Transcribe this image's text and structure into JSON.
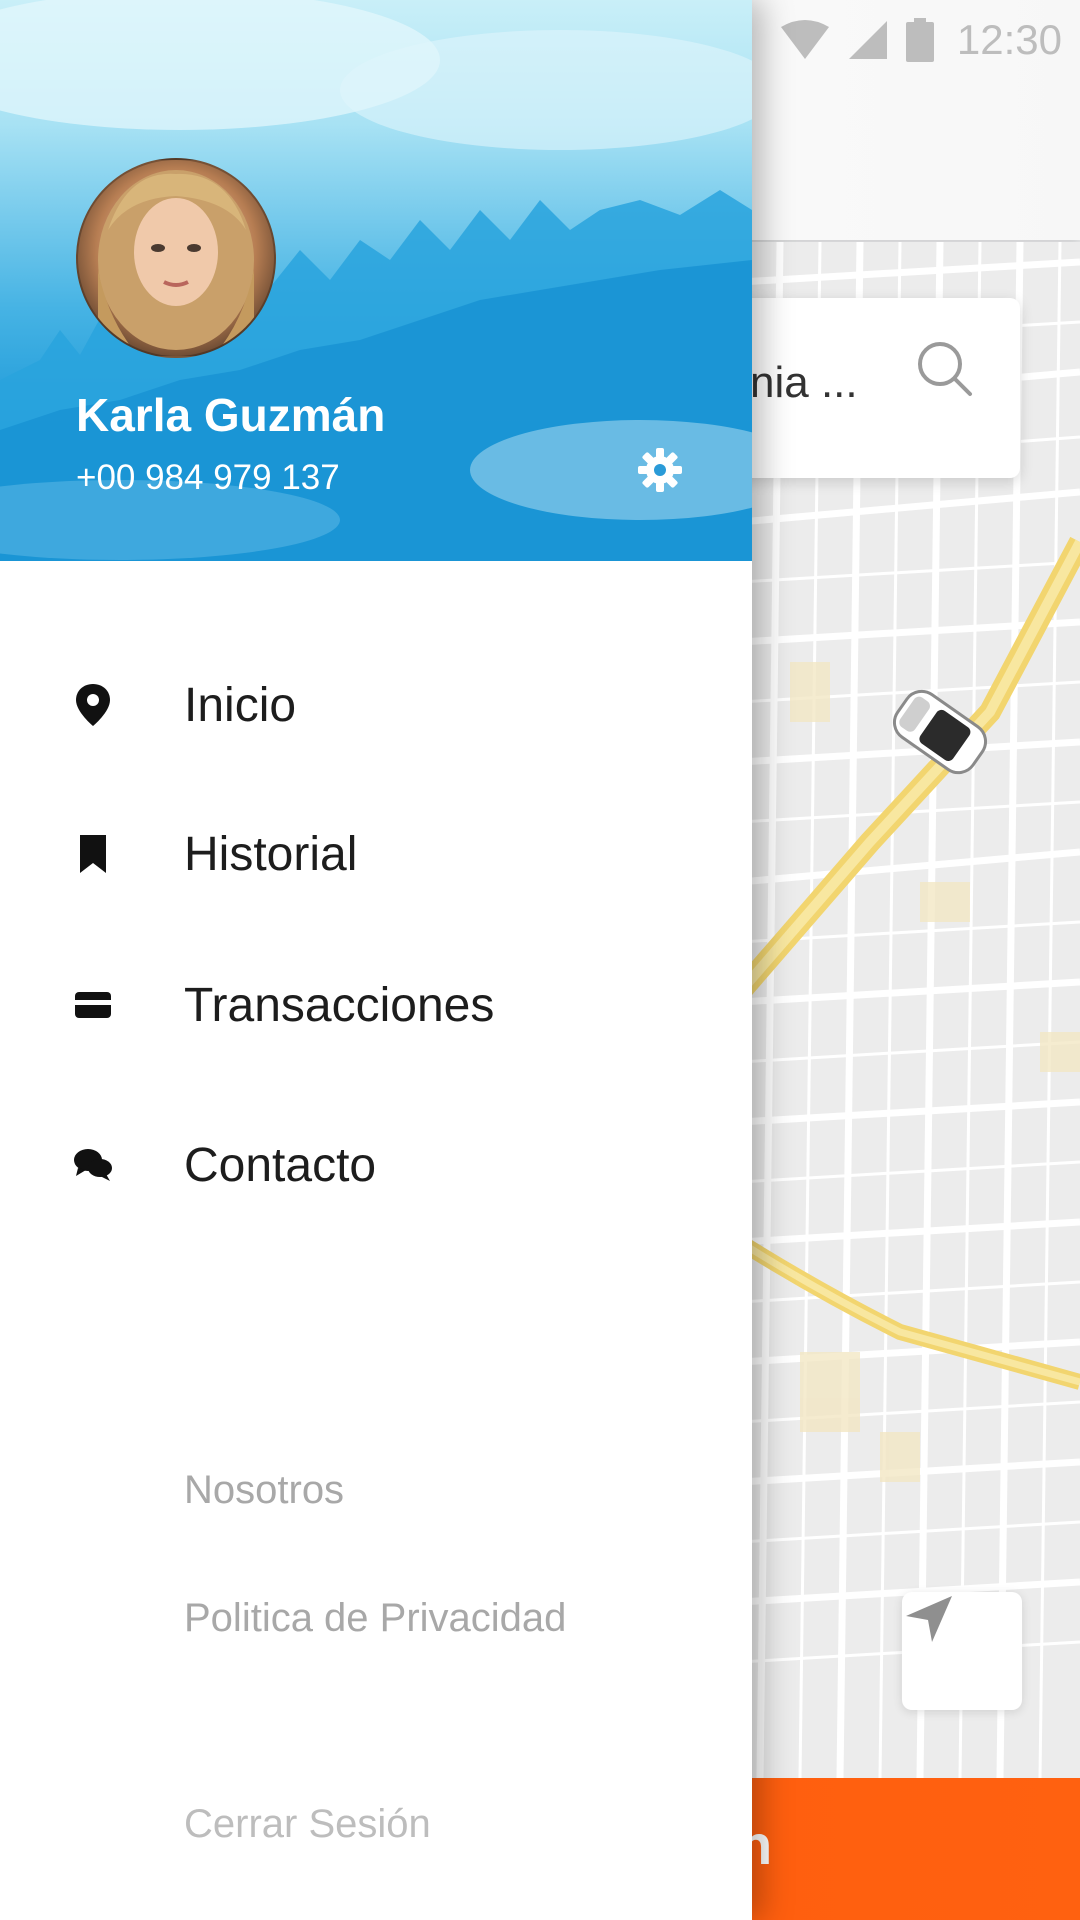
{
  "status_bar": {
    "time": "12:30",
    "icons": [
      "wifi-icon",
      "signal-icon",
      "battery-icon"
    ]
  },
  "background_app": {
    "search": {
      "text_visible": "nia ...",
      "icon": "search-icon"
    },
    "locate_button_icon": "navigation-arrow-icon",
    "cta_label_visible": "n",
    "colors": {
      "cta_orange": "#ff5e0e",
      "route_yellow": "#f6e089"
    }
  },
  "drawer": {
    "profile": {
      "name": "Karla Guzmán",
      "phone": "+00 984 979 137",
      "settings_icon": "gear-icon"
    },
    "menu": [
      {
        "label": "Inicio",
        "icon": "location-pin-icon"
      },
      {
        "label": "Historial",
        "icon": "bookmark-icon"
      },
      {
        "label": "Transacciones",
        "icon": "credit-card-icon"
      },
      {
        "label": "Contacto",
        "icon": "chat-bubbles-icon"
      }
    ],
    "secondary_links": [
      {
        "label": "Nosotros"
      },
      {
        "label": "Politica de Privacidad"
      }
    ],
    "logout": {
      "label": "Cerrar Sesión"
    },
    "colors": {
      "header_blue": "#1b98d8",
      "text_dark": "#1d1d1d",
      "text_muted": "#a8a8a8"
    }
  }
}
